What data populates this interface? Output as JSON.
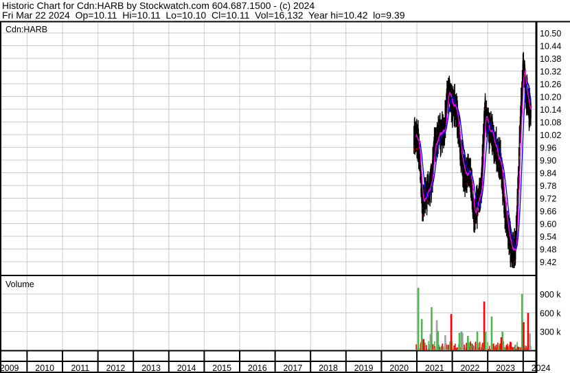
{
  "header": {
    "title": "Historic Chart for Cdn:HARB by Stockwatch.com 604.687.1500 - (c) 2024",
    "quote": "Fri Mar 22 2024  Op=10.11  Hi=10.11  Lo=10.10  Cl=10.11  Vol=16,132  Year hi=10.42  lo=9.39"
  },
  "chart_data": [
    {
      "type": "line",
      "title": "Cdn:HARB",
      "symbol": "Cdn:HARB",
      "ylim": [
        9.39,
        10.52
      ],
      "y_ticks": [
        "10.50",
        "10.44",
        "10.38",
        "10.32",
        "10.26",
        "10.20",
        "10.14",
        "10.08",
        "10.02",
        "9.96",
        "9.90",
        "9.84",
        "9.78",
        "9.72",
        "9.66",
        "9.60",
        "9.54",
        "9.48",
        "9.42"
      ],
      "x_ticks": [
        "2009",
        "2010",
        "2011",
        "2012",
        "2013",
        "2014",
        "2015",
        "2016",
        "2017",
        "2018",
        "2019",
        "2020",
        "2021",
        "2022",
        "2023",
        "2024"
      ],
      "grid": true,
      "colors": {
        "price": "#000000",
        "close_marker": "#ff0000",
        "ma_short": "#ff00ff",
        "ma_long": "#0000ff"
      },
      "series": [
        {
          "points": [
            [
              "2020-12-01",
              10.0
            ],
            [
              "2021-01-15",
              9.99
            ],
            [
              "2021-03-01",
              9.68
            ],
            [
              "2021-04-15",
              9.74
            ],
            [
              "2021-06-01",
              9.8
            ],
            [
              "2021-07-01",
              9.97
            ],
            [
              "2021-08-15",
              10.02
            ],
            [
              "2021-10-15",
              10.05
            ],
            [
              "2021-11-15",
              10.22
            ],
            [
              "2021-12-15",
              10.18
            ],
            [
              "2022-02-15",
              10.14
            ],
            [
              "2022-04-01",
              9.92
            ],
            [
              "2022-05-15",
              9.82
            ],
            [
              "2022-07-01",
              9.86
            ],
            [
              "2022-08-15",
              9.64
            ],
            [
              "2022-10-01",
              9.72
            ],
            [
              "2022-11-01",
              9.8
            ],
            [
              "2022-12-01",
              10.12
            ],
            [
              "2023-01-15",
              10.05
            ],
            [
              "2023-03-15",
              9.97
            ],
            [
              "2023-05-15",
              9.88
            ],
            [
              "2023-07-15",
              9.6
            ],
            [
              "2023-09-01",
              9.48
            ],
            [
              "2023-10-15",
              9.46
            ],
            [
              "2023-12-01",
              10.05
            ],
            [
              "2024-01-01",
              10.36
            ],
            [
              "2024-02-01",
              10.22
            ],
            [
              "2024-03-22",
              10.11
            ]
          ]
        }
      ],
      "extremes": {
        "high": 10.42,
        "low": 9.39
      }
    },
    {
      "type": "bar",
      "title": "Volume",
      "y_ticks": [
        "900 k",
        "600 k",
        "300 k"
      ],
      "colors": {
        "up": "#4cb84c",
        "down": "#ff0000",
        "unchanged": "#a0a0a0"
      },
      "spikes": [
        {
          "date": "2021-01-15",
          "value": 1000000,
          "dir": "up"
        },
        {
          "date": "2021-02-20",
          "value": 500000,
          "dir": "up"
        },
        {
          "date": "2021-03-10",
          "value": 180000,
          "dir": "down"
        },
        {
          "date": "2021-05-20",
          "value": 260000,
          "dir": "unchanged"
        },
        {
          "date": "2021-06-01",
          "value": 690000,
          "dir": "up"
        },
        {
          "date": "2021-07-25",
          "value": 480000,
          "dir": "unchanged"
        },
        {
          "date": "2021-08-05",
          "value": 310000,
          "dir": "up"
        },
        {
          "date": "2021-10-20",
          "value": 240000,
          "dir": "unchanged"
        },
        {
          "date": "2021-12-20",
          "value": 580000,
          "dir": "down"
        },
        {
          "date": "2022-03-15",
          "value": 280000,
          "dir": "up"
        },
        {
          "date": "2022-04-05",
          "value": 300000,
          "dir": "up"
        },
        {
          "date": "2022-04-15",
          "value": 280000,
          "dir": "unchanged"
        },
        {
          "date": "2022-06-10",
          "value": 230000,
          "dir": "up"
        },
        {
          "date": "2022-09-15",
          "value": 300000,
          "dir": "up"
        },
        {
          "date": "2022-11-25",
          "value": 780000,
          "dir": "down"
        },
        {
          "date": "2022-12-10",
          "value": 300000,
          "dir": "up"
        },
        {
          "date": "2023-02-10",
          "value": 540000,
          "dir": "up"
        },
        {
          "date": "2023-06-01",
          "value": 300000,
          "dir": "up"
        },
        {
          "date": "2023-05-20",
          "value": 210000,
          "dir": "down"
        },
        {
          "date": "2023-12-20",
          "value": 900000,
          "dir": "up"
        },
        {
          "date": "2024-01-05",
          "value": 450000,
          "dir": "down"
        },
        {
          "date": "2024-02-20",
          "value": 600000,
          "dir": "down"
        },
        {
          "date": "2024-03-10",
          "value": 270000,
          "dir": "unchanged"
        }
      ]
    }
  ]
}
